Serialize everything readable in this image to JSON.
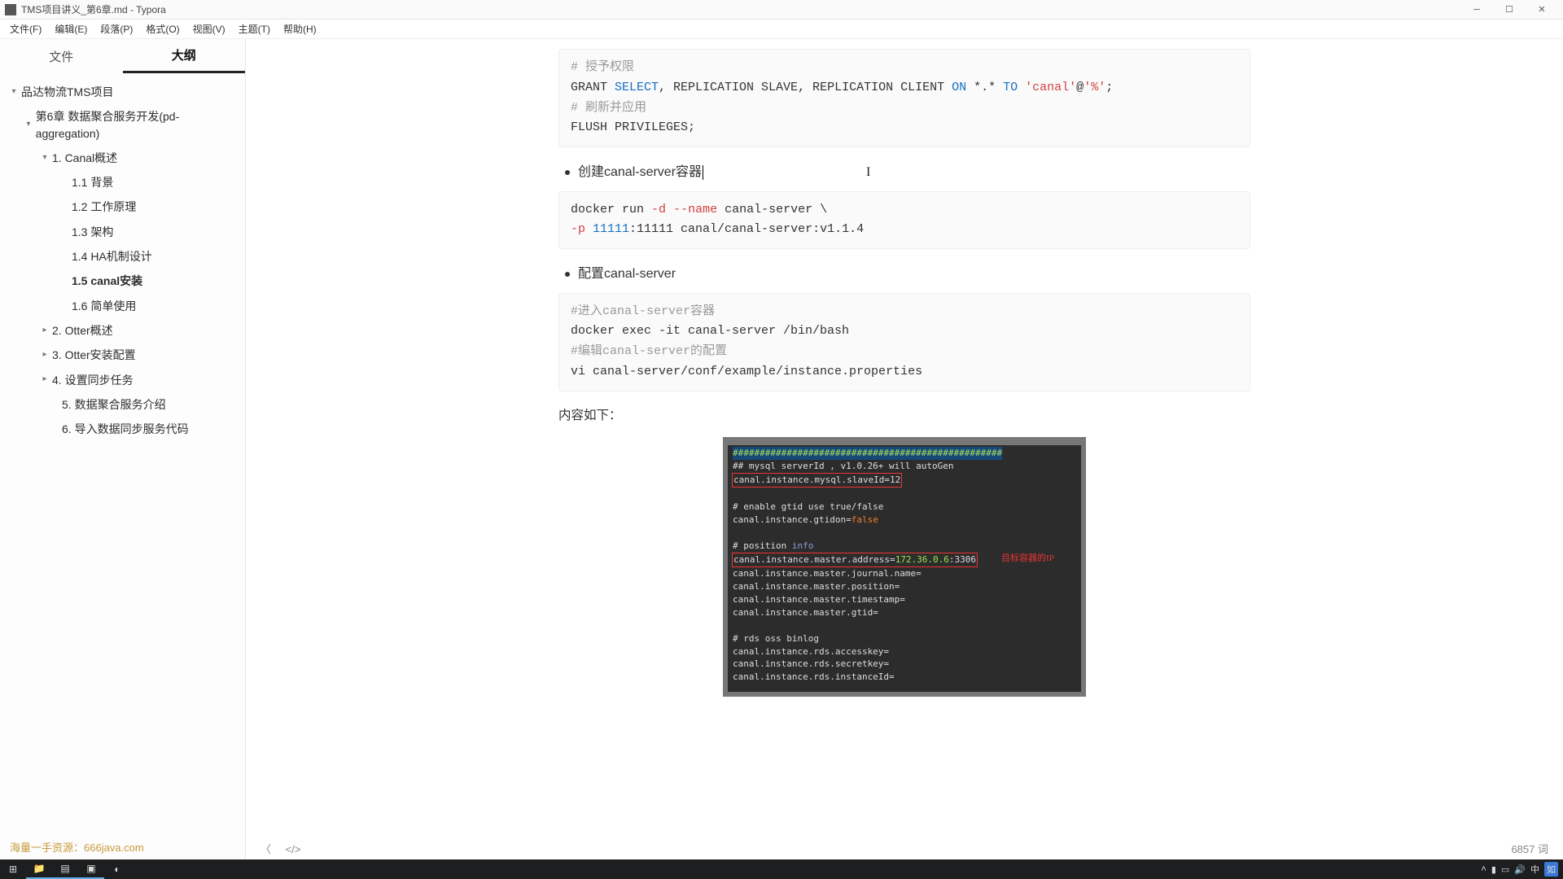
{
  "window": {
    "title": "TMS项目讲义_第6章.md - Typora"
  },
  "menu": {
    "file": "文件(F)",
    "edit": "编辑(E)",
    "paragraph": "段落(P)",
    "format": "格式(O)",
    "view": "视图(V)",
    "theme": "主题(T)",
    "help": "帮助(H)"
  },
  "side_tabs": {
    "files": "文件",
    "outline": "大纲"
  },
  "outline": {
    "root": "品达物流TMS项目",
    "chapter": "第6章 数据聚合服务开发(pd-aggregation)",
    "n1": "1. Canal概述",
    "n1_1": "1.1 背景",
    "n1_2": "1.2 工作原理",
    "n1_3": "1.3 架构",
    "n1_4": "1.4 HA机制设计",
    "n1_5": "1.5 canal安装",
    "n1_6": "1.6 简单使用",
    "n2": "2. Otter概述",
    "n3": "3. Otter安装配置",
    "n4": "4. 设置同步任务",
    "n5": "5. 数据聚合服务介绍",
    "n6": "6. 导入数据同步服务代码"
  },
  "content": {
    "code1": {
      "c1": "# 授予权限",
      "l2a": "GRANT ",
      "l2b": "SELECT",
      "l2c": ", REPLICATION SLAVE, REPLICATION CLIENT ",
      "l2d": "ON",
      "l2e": " *.* ",
      "l2f": "TO",
      "l2g": " ",
      "l2h": "'canal'",
      "l2i": "@",
      "l2j": "'%'",
      "l2k": ";",
      "c2": "# 刷新并应用",
      "l4": "FLUSH PRIVILEGES;"
    },
    "bullet1": "创建canal-server容器",
    "code2": {
      "l1a": "docker run ",
      "l1b": "-d",
      "l1c": " ",
      "l1d": "--name",
      "l1e": " canal-server \\",
      "l2a": "-p",
      "l2b": " 11111",
      "l2c": ":11111 canal/canal-server:v1.1.4"
    },
    "bullet2": "配置canal-server",
    "code3": {
      "c1": "#进入canal-server容器",
      "l2": "docker exec -it canal-server /bin/bash",
      "c2": "#编辑canal-server的配置",
      "l4": "vi canal-server/conf/example/instance.properties"
    },
    "para1": "内容如下：",
    "shot": {
      "hash": "##################################################",
      "l1": "## mysql serverId , v1.0.26+ will autoGen",
      "l2a": "canal.instance.mysql.slaveId=12",
      "l3": "# enable gtid use true/false",
      "l4a": "canal.instance.gtidon=",
      "l4b": "false",
      "l5a": "# position ",
      "l5b": "info",
      "l6a": "canal.instance.master.address=",
      "l6b": "172.36.0.6",
      "l6c": ":3306",
      "l6label": "目标容器的IP",
      "l7": "canal.instance.master.journal.name=",
      "l8": "canal.instance.master.position=",
      "l9": "canal.instance.master.timestamp=",
      "l10": "canal.instance.master.gtid=",
      "l11": "# rds oss binlog",
      "l12": "canal.instance.rds.accesskey=",
      "l13": "canal.instance.rds.secretkey=",
      "l14": "canal.instance.rds.instanceId="
    }
  },
  "footer_promo": "海量一手资源：666java.com",
  "status": {
    "wordcount": "6857 词"
  }
}
